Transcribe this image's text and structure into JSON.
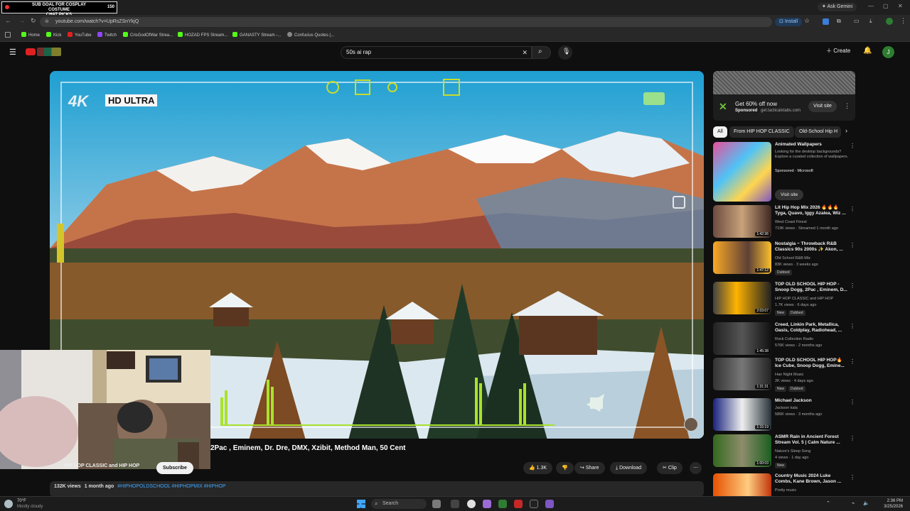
{
  "stream_overlay": {
    "goal_text": "SUB GOAL FOR COSPLAY COSTUME",
    "sub_text": "CHAT PICKS",
    "count": "150",
    "tab_hint": "TOP OLD SCH"
  },
  "browser": {
    "ask_gemini": "Ask Gemini",
    "url": "youtube.com/watch?v=UpRsZSnYkjQ",
    "install_label": "Install",
    "bookmarks": [
      "Home",
      "Kick",
      "YouTube",
      "Twitch",
      "CrisGodOfWar Strea...",
      "HOZAD FPS Stream...",
      "GANASTY Stream -...",
      "Confucius Quotes (..."
    ]
  },
  "youtube": {
    "search_query": "50s ai rap",
    "create_label": "Create",
    "avatar_letter": "J"
  },
  "player": {
    "hd_label": "HD ULTRA",
    "fourk": "4K"
  },
  "video": {
    "title": "2Pac , Eminem, Dr. Dre, DMX, Xzibit, Method Man, 50 Cent",
    "channel": "HIP HOP CLASSIC and HIP HOP",
    "subscribe_label": "Subscribe",
    "likes": "1.3K",
    "share": "Share",
    "download": "Download",
    "clip": "Clip",
    "views": "132K views",
    "age": "1 month ago",
    "tags": "#HIPHOPOLDSCHOOL #HIPHOPMIX #HIPHOP",
    "desc_line": "TOP OLD SCHOOL HIP HOP Ice Cube, Snoop Dogg,2Pac , Eminem, Dr. Dre, DMX, Xzibit, Method Man, 50 Cent"
  },
  "sidebar": {
    "ad": {
      "headline": "Get 60% off now",
      "sponsored": "Sponsored",
      "domain": "get.tacticalxtabs.com",
      "cta": "Visit site"
    },
    "chips": [
      "All",
      "From HIP HOP CLASSIC",
      "Old-School Hip H"
    ],
    "recs": [
      {
        "title": "Animated Wallpapers",
        "channel": "Looking for the desktop backgrounds? Explore a curated collection of wallpapers.",
        "meta": "Sponsored · Microsoft",
        "duration": "",
        "badges": [],
        "cta": "Visit site"
      },
      {
        "title": "Lit Hip Hop Mix 2026 🔥🔥🔥 Tyga, Quavo, Iggy Azalea, Wiz ...",
        "channel": "West Coast Finest",
        "meta": "719K views · Streamed 1 month ago",
        "duration": "1:42:36",
        "badges": []
      },
      {
        "title": "Nostalgia ~ Throwback R&B Classics 90s 2000s ✨ Akon, ...",
        "channel": "Old School R&B Mix",
        "meta": "83K views · 3 weeks ago",
        "duration": "1:47:12",
        "badges": [
          "Dubbed"
        ]
      },
      {
        "title": "TOP OLD SCHOOL HIP HOP - Snoop Dogg, 2Pac , Eminem, D...",
        "channel": "HIP HOP CLASSIC and HIP HOP",
        "meta": "1.7K views · 6 days ago",
        "duration": "2:03:07",
        "badges": [
          "New",
          "Dubbed"
        ]
      },
      {
        "title": "Creed, Linkin Park, Metallica, Oasis, Coldplay, Radiohead, ...",
        "channel": "Rock Collection Radio",
        "meta": "576K views · 2 months ago",
        "duration": "1:45:38",
        "badges": []
      },
      {
        "title": "TOP OLD SCHOOL HIP HOP🔥 Ice Cube, Snoop Dogg, Emine...",
        "channel": "Han Night Music",
        "meta": "2K views · 4 days ago",
        "duration": "1:31:31",
        "badges": [
          "New",
          "Dubbed"
        ]
      },
      {
        "title": "Michael Jackson",
        "channel": "Jackson kala",
        "meta": "586K views · 3 months ago",
        "duration": "1:15:19",
        "badges": []
      },
      {
        "title": "ASMR Rain in Ancient Forest Stream Vol. 5 | Calm Nature ...",
        "channel": "Nature's Sleep Song",
        "meta": "4 views · 1 day ago",
        "duration": "1:00:03",
        "badges": [
          "New"
        ]
      },
      {
        "title": "Country Music 2024 Luke Combs, Kane Brown, Jason ...",
        "channel": "Pretty music",
        "meta": "",
        "duration": "",
        "badges": []
      }
    ]
  },
  "taskbar": {
    "weather_temp": "70°F",
    "weather_desc": "Mostly cloudy",
    "search_placeholder": "Search",
    "time": "2:36 PM",
    "date": "3/25/2026"
  }
}
